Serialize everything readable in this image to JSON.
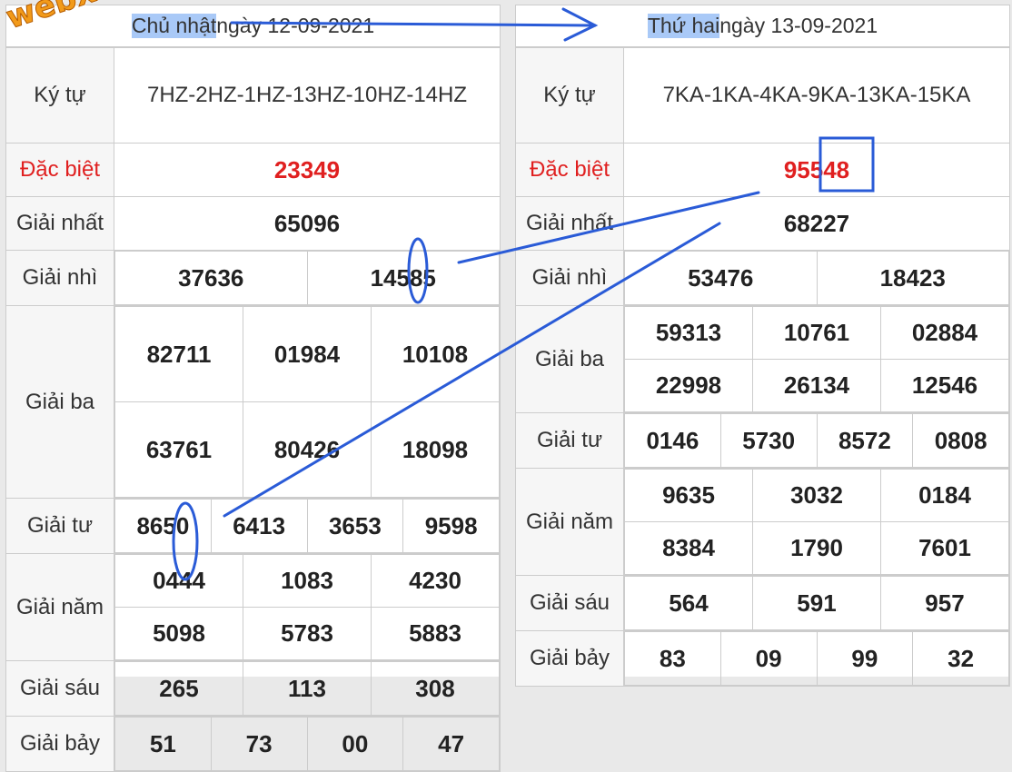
{
  "watermark": "webxoso.net",
  "left": {
    "day": "Chủ nhật",
    "date_text": " ngày 12-09-2021",
    "labels": {
      "kytu": "Ký tự",
      "db": "Đặc biệt",
      "g1": "Giải nhất",
      "g2": "Giải nhì",
      "g3": "Giải ba",
      "g4": "Giải tư",
      "g5": "Giải năm",
      "g6": "Giải sáu",
      "g7": "Giải bảy"
    },
    "kytu": "7HZ-2HZ-1HZ-13HZ-10HZ-14HZ",
    "db": "23349",
    "g1": "65096",
    "g2": [
      "37636",
      "14585"
    ],
    "g3": [
      "82711",
      "01984",
      "10108",
      "63761",
      "80426",
      "18098"
    ],
    "g4": [
      "8650",
      "6413",
      "3653",
      "9598"
    ],
    "g5": [
      "0444",
      "1083",
      "4230",
      "5098",
      "5783",
      "5883"
    ],
    "g6": [
      "265",
      "113",
      "308"
    ],
    "g7": [
      "51",
      "73",
      "00",
      "47"
    ]
  },
  "right": {
    "day": "Thứ hai",
    "date_text": " ngày 13-09-2021",
    "labels": {
      "kytu": "Ký tự",
      "db": "Đặc biệt",
      "g1": "Giải nhất",
      "g2": "Giải nhì",
      "g3": "Giải ba",
      "g4": "Giải tư",
      "g5": "Giải năm",
      "g6": "Giải sáu",
      "g7": "Giải bảy"
    },
    "kytu": "7KA-1KA-4KA-9KA-13KA-15KA",
    "db": "95548",
    "g1": "68227",
    "g2": [
      "53476",
      "18423"
    ],
    "g3": [
      "59313",
      "10761",
      "02884",
      "22998",
      "26134",
      "12546"
    ],
    "g4": [
      "0146",
      "5730",
      "8572",
      "0808"
    ],
    "g5": [
      "9635",
      "3032",
      "0184",
      "8384",
      "1790",
      "7601"
    ],
    "g6": [
      "564",
      "591",
      "957"
    ],
    "g7": [
      "83",
      "09",
      "99",
      "32"
    ]
  },
  "colors": {
    "annotation": "#2a5bd7",
    "special": "#e02020",
    "highlight": "#a9c9f7",
    "watermark": "#f29a1a"
  }
}
